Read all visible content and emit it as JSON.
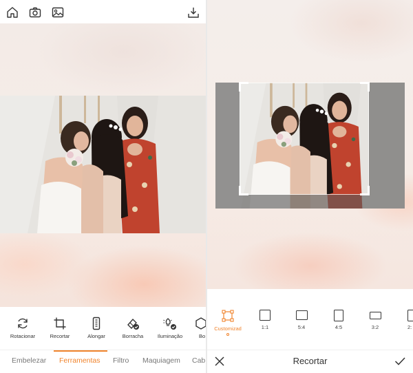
{
  "colors": {
    "accent": "#f0832b",
    "icon": "#333333",
    "tab_inactive": "#777777",
    "dim_overlay": "rgba(90,90,90,0.62)"
  },
  "left_panel": {
    "top_bar": {
      "icons": [
        "home-icon",
        "camera-icon",
        "gallery-icon",
        "download-icon"
      ]
    },
    "tools": [
      {
        "label": "Rotacionar",
        "icon": "rotate-icon"
      },
      {
        "label": "Recortar",
        "icon": "crop-icon"
      },
      {
        "label": "Alongar",
        "icon": "stretch-icon"
      },
      {
        "label": "Borracha",
        "icon": "eraser-icon"
      },
      {
        "label": "Iluminação",
        "icon": "lighting-icon"
      },
      {
        "label": "Bo",
        "icon": "cube-icon"
      }
    ],
    "tabs": [
      {
        "label": "Embelezar",
        "active": false
      },
      {
        "label": "Ferramentas",
        "active": true
      },
      {
        "label": "Filtro",
        "active": false
      },
      {
        "label": "Maquiagem",
        "active": false
      },
      {
        "label": "Cab",
        "active": false
      }
    ]
  },
  "right_panel": {
    "ratios": [
      {
        "label": "Customizad",
        "icon": "custom-crop-icon",
        "active": true
      },
      {
        "label": "1:1",
        "icon": "ratio-1-1-icon",
        "active": false
      },
      {
        "label": "5:4",
        "icon": "ratio-5-4-icon",
        "active": false
      },
      {
        "label": "4:5",
        "icon": "ratio-4-5-icon",
        "active": false
      },
      {
        "label": "3:2",
        "icon": "ratio-3-2-icon",
        "active": false
      },
      {
        "label": "2:",
        "icon": "ratio-2-3-icon",
        "active": false
      }
    ],
    "bottom_bar": {
      "title": "Recortar",
      "cancel_icon": "close-icon",
      "confirm_icon": "check-icon"
    }
  }
}
